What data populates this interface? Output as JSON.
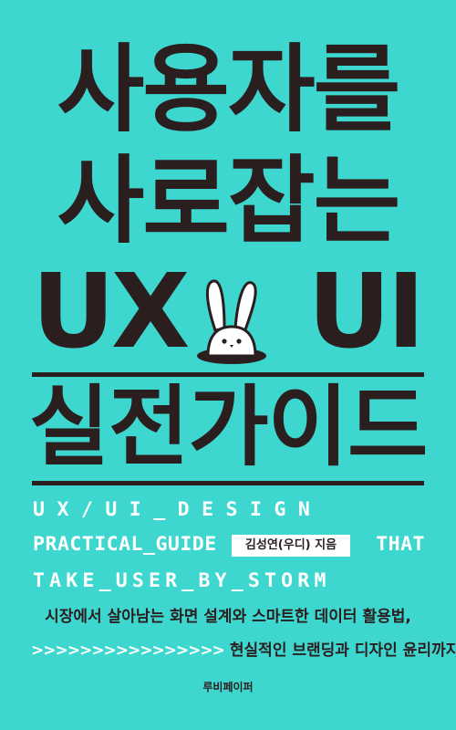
{
  "title": {
    "line1": "사용자를",
    "line2": "사로잡는",
    "ux": "UX",
    "ui": "UI",
    "line4": "실전가이드"
  },
  "english": {
    "line1": "UX/UI_DESIGN",
    "line2_left": "PRACTICAL_GUIDE",
    "line2_right": "THAT",
    "line3": "TAKE_USER_BY_STORM"
  },
  "author": "김성연(우디) 지음",
  "description": {
    "line1": "시장에서 살아남는 화면 설계와 스마트한 데이터 활용법,",
    "chevrons": ">>>>>>>>>>>>>>>>",
    "line2": "현실적인 브랜딩과 디자인 윤리까지"
  },
  "publisher": "루비페이퍼",
  "colors": {
    "background": "#3ED7CF",
    "title": "#2B1E1F",
    "english": "#FFFFFF"
  },
  "icons": [
    "rabbit-in-hole-icon"
  ]
}
